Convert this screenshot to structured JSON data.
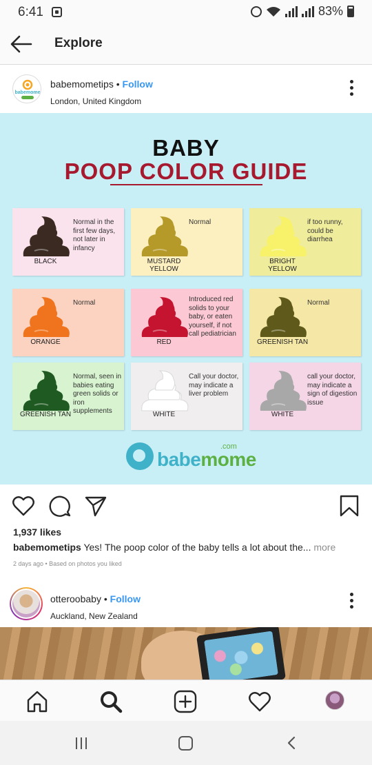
{
  "status_bar": {
    "time": "6:41",
    "battery": "83%"
  },
  "app_bar": {
    "title": "Explore"
  },
  "post1": {
    "username": "babemometips",
    "follow_label": "Follow",
    "separator": "•",
    "location": "London, United Kingdom",
    "avatar_text": "babemome",
    "likes": "1,937 likes",
    "caption_user": "babemometips",
    "caption_text": "Yes! The poop color of the baby tells a lot about the...",
    "caption_more": "more",
    "meta": "2 days ago • Based on photos you liked"
  },
  "infographic": {
    "title_line1": "BABY",
    "title_line2": "POOP COLOR GUIDE",
    "brand_name_a": "babe",
    "brand_name_b": "mome",
    "brand_com": ".com",
    "cards": [
      {
        "label": "BLACK",
        "note": "Normal in the first few days, not later in infancy",
        "bg": "#fbe3ee",
        "color": "#3a2a22"
      },
      {
        "label": "MUSTARD YELLOW",
        "note": "Normal",
        "bg": "#fdf0c0",
        "color": "#b59a2a"
      },
      {
        "label": "BRIGHT YELLOW",
        "note": "if too runny, could be diarrhea",
        "bg": "#efec9c",
        "color": "#f7f26a"
      },
      {
        "label": "ORANGE",
        "note": "Normal",
        "bg": "#fbd3c0",
        "color": "#f0741e"
      },
      {
        "label": "RED",
        "note": "Introduced red solids to your baby, or eaten yourself, if not call pediatrician",
        "bg": "#fbc8d3",
        "color": "#c41430"
      },
      {
        "label": "GREENISH TAN",
        "note": "Normal",
        "bg": "#f5e8a6",
        "color": "#5f5a1c"
      },
      {
        "label": "GREENISH TAN",
        "note": "Normal, seen in babies eating green solids or iron supplements",
        "bg": "#d7f3cf",
        "color": "#1f5a22"
      },
      {
        "label": "WHITE",
        "note": "Call your doctor, may indicate a liver problem",
        "bg": "#f0eeee",
        "color": "#ffffff"
      },
      {
        "label": "WHITE",
        "note": "call your doctor, may indicate a sign of digestion issue",
        "bg": "#f5d6e6",
        "color": "#a8a8a8"
      }
    ]
  },
  "post2": {
    "username": "otteroobaby",
    "follow_label": "Follow",
    "separator": "•",
    "location": "Auckland, New Zealand"
  },
  "icons": {
    "back": "arrow-left-icon",
    "more": "kebab-icon",
    "like": "heart-icon",
    "comment": "comment-icon",
    "share": "paper-plane-icon",
    "save": "bookmark-icon",
    "home": "home-icon",
    "search": "search-icon",
    "add": "add-post-icon",
    "activity": "heart-icon"
  }
}
